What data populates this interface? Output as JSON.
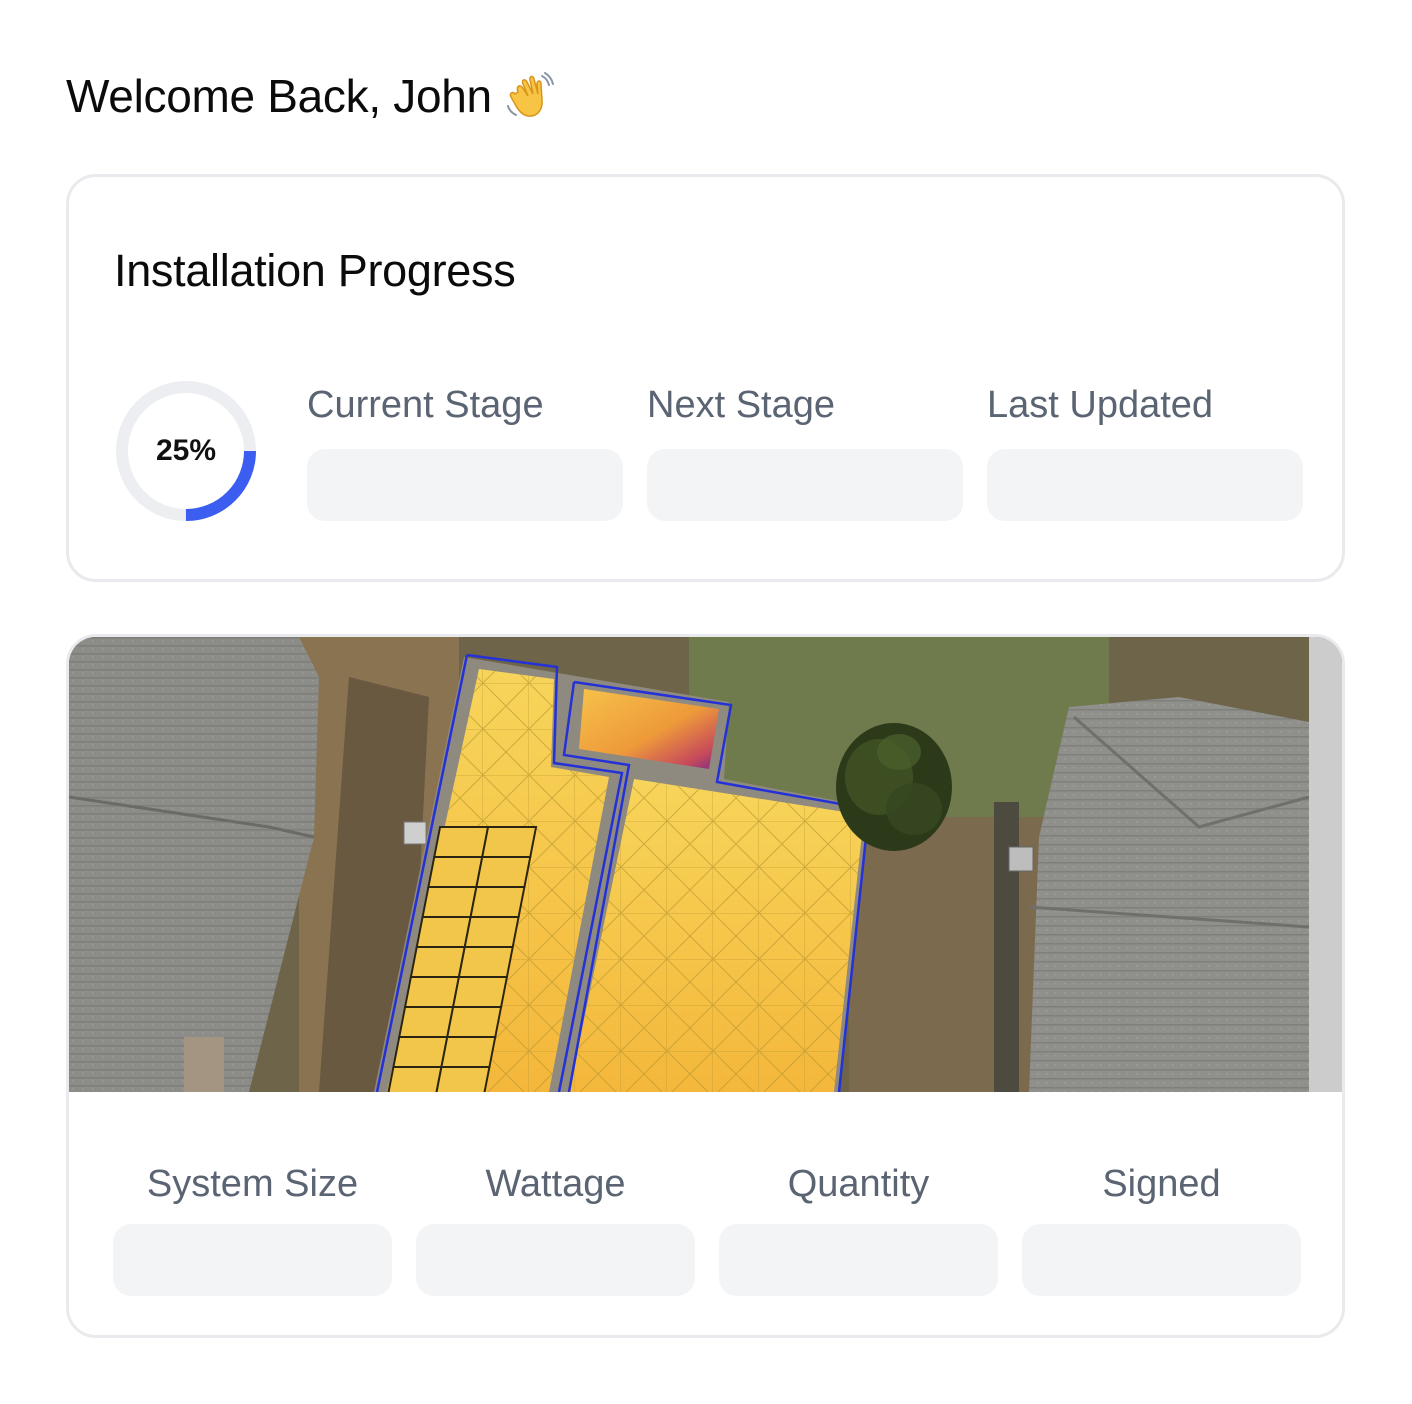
{
  "header": {
    "welcome": "Welcome Back, John",
    "wave_icon": "waving-hand-icon"
  },
  "progress": {
    "title": "Installation Progress",
    "percent": 25,
    "percent_label": "25%",
    "accent_color": "#3b5ef0",
    "track_color": "#eceef1",
    "stats": [
      {
        "label": "Current Stage",
        "value": ""
      },
      {
        "label": "Next Stage",
        "value": ""
      },
      {
        "label": "Last Updated",
        "value": ""
      }
    ]
  },
  "system": {
    "stats": [
      {
        "label": "System Size",
        "value": ""
      },
      {
        "label": "Wattage",
        "value": ""
      },
      {
        "label": "Quantity",
        "value": ""
      },
      {
        "label": "Signed",
        "value": ""
      }
    ]
  }
}
